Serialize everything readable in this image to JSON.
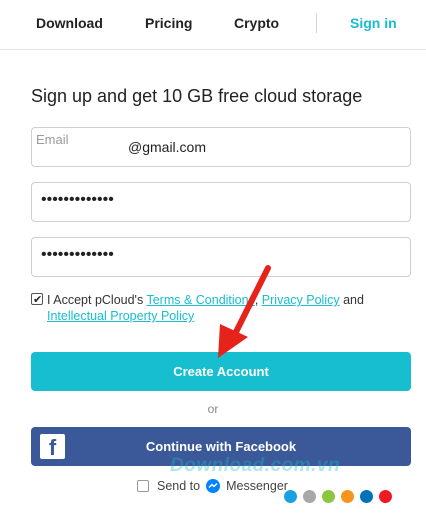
{
  "nav": {
    "download": "Download",
    "pricing": "Pricing",
    "crypto": "Crypto",
    "signin": "Sign in"
  },
  "heading": "Sign up and get 10 GB free cloud storage",
  "email": {
    "label": "Email",
    "value": "@gmail.com"
  },
  "password": {
    "mask": "•••••••••••••"
  },
  "password_repeat": {
    "mask": "•••••••••••••"
  },
  "terms": {
    "checked": true,
    "prefix": "I Accept pCloud's",
    "terms_link": "Terms & Conditions",
    "sep": ",",
    "privacy_link": "Privacy Policy",
    "and": "and",
    "ip_link": "Intellectual Property Policy"
  },
  "create_button": "Create Account",
  "or_text": "or",
  "facebook_button": "Continue with Facebook",
  "messenger": {
    "checked": false,
    "prefix": "Send to",
    "label": "Messenger"
  },
  "watermark": "Download.com.vn",
  "colors": {
    "accent": "#17bed0",
    "facebook": "#3b5998",
    "arrow": "#e5231b",
    "dots": [
      "#1ba1e2",
      "#a8a8a8",
      "#8cc63e",
      "#f7941d",
      "#0072bc",
      "#ed1c24"
    ]
  },
  "icons": {
    "facebook": "facebook-logo-icon",
    "messenger": "messenger-icon",
    "arrow": "red-arrow-annotation"
  }
}
